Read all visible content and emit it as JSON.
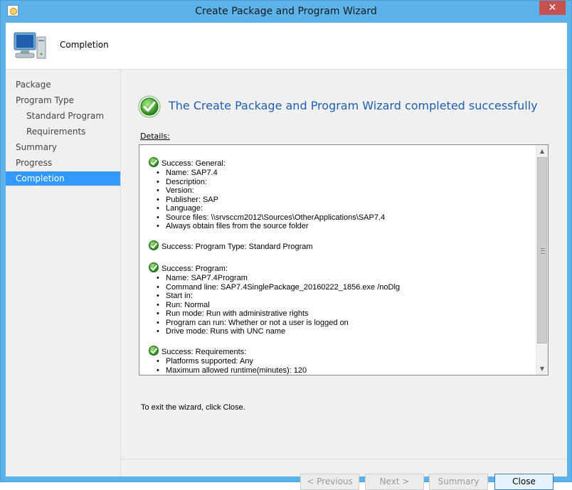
{
  "window": {
    "title": "Create Package and Program Wizard",
    "close_glyph": "✕"
  },
  "header": {
    "title": "Completion"
  },
  "nav": {
    "items": [
      {
        "label": "Package"
      },
      {
        "label": "Program Type"
      },
      {
        "label": "Standard Program"
      },
      {
        "label": "Requirements"
      },
      {
        "label": "Summary"
      },
      {
        "label": "Progress"
      },
      {
        "label": "Completion",
        "active": true
      }
    ]
  },
  "main": {
    "headline": "The Create Package and Program Wizard completed successfully",
    "details_label": "Details:",
    "sections": [
      {
        "heading": "Success: General:",
        "items": [
          "Name: SAP7.4",
          "Description:",
          "Version:",
          "Publisher: SAP",
          "Language:",
          "Source files: \\\\srvsccm2012\\Sources\\OtherApplications\\SAP7.4",
          "Always obtain files from the source folder"
        ]
      },
      {
        "heading": "Success: Program Type: Standard Program",
        "items": []
      },
      {
        "heading": "Success: Program:",
        "items": [
          "Name: SAP7.4Program",
          "Command line: SAP7.4SinglePackage_20160222_1856.exe /noDlg",
          "Start in:",
          "Run: Normal",
          "Run mode: Run with administrative rights",
          "Program can run: Whether or not a user is logged on",
          "Drive mode: Runs with UNC name"
        ]
      },
      {
        "heading": "Success: Requirements:",
        "items": [
          "Platforms supported: Any",
          "Maximum allowed runtime(minutes): 120"
        ]
      }
    ],
    "exit_text": "To exit the wizard, click Close."
  },
  "buttons": {
    "previous": "< Previous",
    "next": "Next >",
    "summary": "Summary",
    "close": "Close"
  },
  "colors": {
    "titlebar": "#5cb3ec",
    "nav_active": "#3399ff",
    "headline": "#1e5fb0",
    "close_button": "#c75050"
  }
}
